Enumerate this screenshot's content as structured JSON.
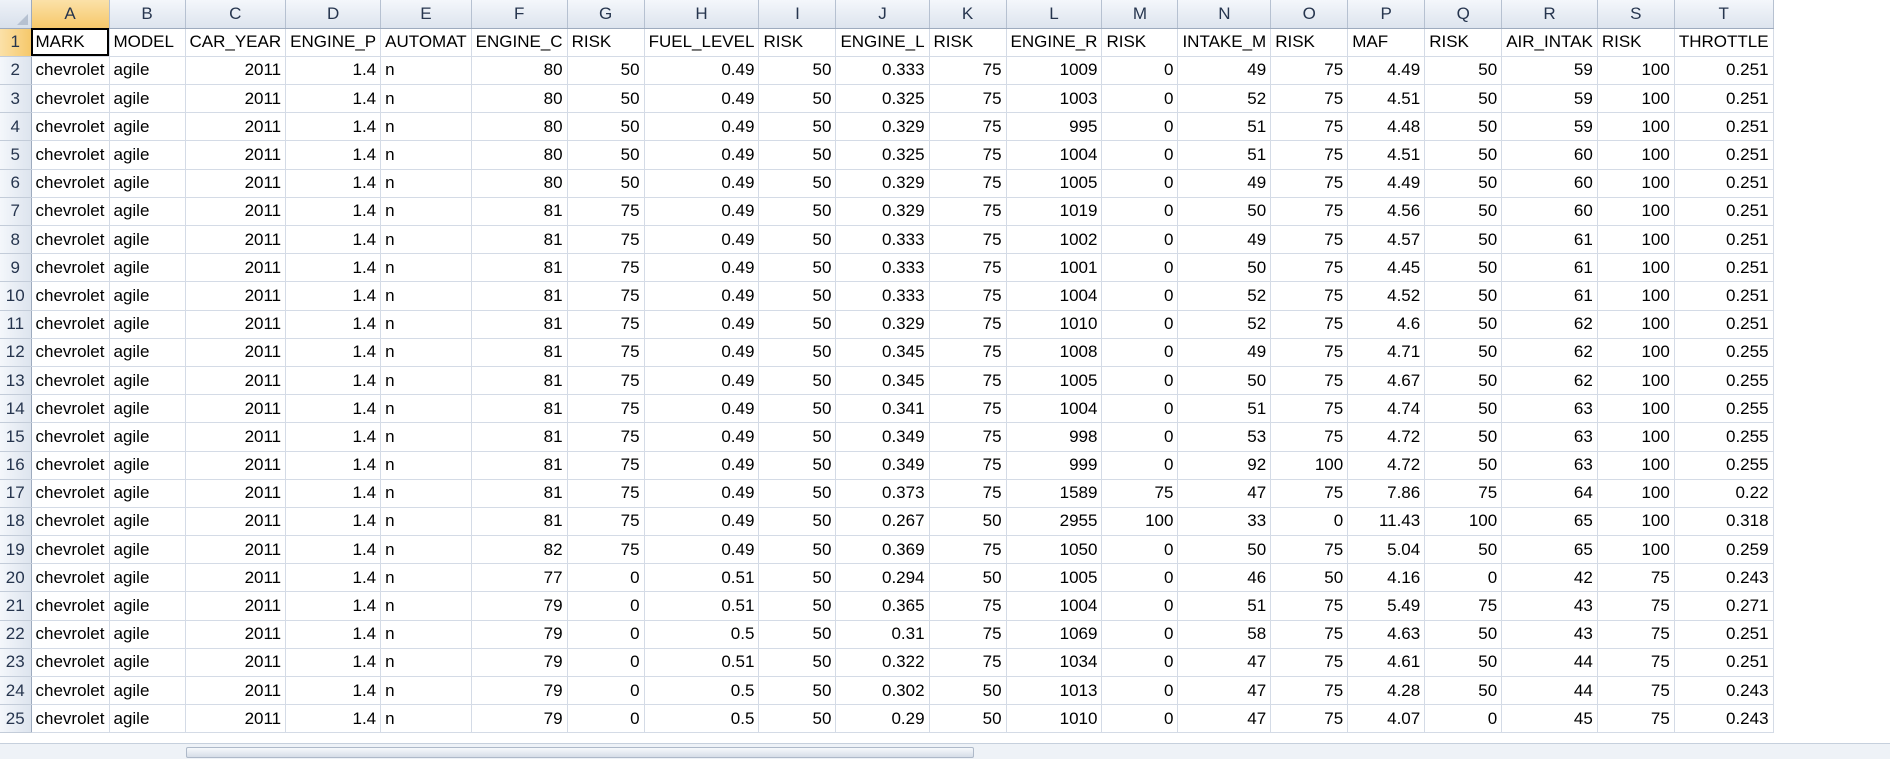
{
  "columns": [
    "A",
    "B",
    "C",
    "D",
    "E",
    "F",
    "G",
    "H",
    "I",
    "J",
    "K",
    "L",
    "M",
    "N",
    "O",
    "P",
    "Q",
    "R",
    "S",
    "T"
  ],
  "header_row": [
    "MARK",
    "MODEL",
    "CAR_YEAR",
    "ENGINE_P",
    "AUTOMAT",
    "ENGINE_C",
    "RISK",
    "FUEL_LEVEL",
    "RISK",
    "ENGINE_L",
    "RISK",
    "ENGINE_R",
    "RISK",
    "INTAKE_M",
    "RISK",
    "MAF",
    "RISK",
    "AIR_INTAK",
    "RISK",
    "THROTTLE"
  ],
  "rows": [
    [
      "chevrolet",
      "agile",
      "2011",
      "1.4",
      "n",
      "80",
      "50",
      "0.49",
      "50",
      "0.333",
      "75",
      "1009",
      "0",
      "49",
      "75",
      "4.49",
      "50",
      "59",
      "100",
      "0.251"
    ],
    [
      "chevrolet",
      "agile",
      "2011",
      "1.4",
      "n",
      "80",
      "50",
      "0.49",
      "50",
      "0.325",
      "75",
      "1003",
      "0",
      "52",
      "75",
      "4.51",
      "50",
      "59",
      "100",
      "0.251"
    ],
    [
      "chevrolet",
      "agile",
      "2011",
      "1.4",
      "n",
      "80",
      "50",
      "0.49",
      "50",
      "0.329",
      "75",
      "995",
      "0",
      "51",
      "75",
      "4.48",
      "50",
      "59",
      "100",
      "0.251"
    ],
    [
      "chevrolet",
      "agile",
      "2011",
      "1.4",
      "n",
      "80",
      "50",
      "0.49",
      "50",
      "0.325",
      "75",
      "1004",
      "0",
      "51",
      "75",
      "4.51",
      "50",
      "60",
      "100",
      "0.251"
    ],
    [
      "chevrolet",
      "agile",
      "2011",
      "1.4",
      "n",
      "80",
      "50",
      "0.49",
      "50",
      "0.329",
      "75",
      "1005",
      "0",
      "49",
      "75",
      "4.49",
      "50",
      "60",
      "100",
      "0.251"
    ],
    [
      "chevrolet",
      "agile",
      "2011",
      "1.4",
      "n",
      "81",
      "75",
      "0.49",
      "50",
      "0.329",
      "75",
      "1019",
      "0",
      "50",
      "75",
      "4.56",
      "50",
      "60",
      "100",
      "0.251"
    ],
    [
      "chevrolet",
      "agile",
      "2011",
      "1.4",
      "n",
      "81",
      "75",
      "0.49",
      "50",
      "0.333",
      "75",
      "1002",
      "0",
      "49",
      "75",
      "4.57",
      "50",
      "61",
      "100",
      "0.251"
    ],
    [
      "chevrolet",
      "agile",
      "2011",
      "1.4",
      "n",
      "81",
      "75",
      "0.49",
      "50",
      "0.333",
      "75",
      "1001",
      "0",
      "50",
      "75",
      "4.45",
      "50",
      "61",
      "100",
      "0.251"
    ],
    [
      "chevrolet",
      "agile",
      "2011",
      "1.4",
      "n",
      "81",
      "75",
      "0.49",
      "50",
      "0.333",
      "75",
      "1004",
      "0",
      "52",
      "75",
      "4.52",
      "50",
      "61",
      "100",
      "0.251"
    ],
    [
      "chevrolet",
      "agile",
      "2011",
      "1.4",
      "n",
      "81",
      "75",
      "0.49",
      "50",
      "0.329",
      "75",
      "1010",
      "0",
      "52",
      "75",
      "4.6",
      "50",
      "62",
      "100",
      "0.251"
    ],
    [
      "chevrolet",
      "agile",
      "2011",
      "1.4",
      "n",
      "81",
      "75",
      "0.49",
      "50",
      "0.345",
      "75",
      "1008",
      "0",
      "49",
      "75",
      "4.71",
      "50",
      "62",
      "100",
      "0.255"
    ],
    [
      "chevrolet",
      "agile",
      "2011",
      "1.4",
      "n",
      "81",
      "75",
      "0.49",
      "50",
      "0.345",
      "75",
      "1005",
      "0",
      "50",
      "75",
      "4.67",
      "50",
      "62",
      "100",
      "0.255"
    ],
    [
      "chevrolet",
      "agile",
      "2011",
      "1.4",
      "n",
      "81",
      "75",
      "0.49",
      "50",
      "0.341",
      "75",
      "1004",
      "0",
      "51",
      "75",
      "4.74",
      "50",
      "63",
      "100",
      "0.255"
    ],
    [
      "chevrolet",
      "agile",
      "2011",
      "1.4",
      "n",
      "81",
      "75",
      "0.49",
      "50",
      "0.349",
      "75",
      "998",
      "0",
      "53",
      "75",
      "4.72",
      "50",
      "63",
      "100",
      "0.255"
    ],
    [
      "chevrolet",
      "agile",
      "2011",
      "1.4",
      "n",
      "81",
      "75",
      "0.49",
      "50",
      "0.349",
      "75",
      "999",
      "0",
      "92",
      "100",
      "4.72",
      "50",
      "63",
      "100",
      "0.255"
    ],
    [
      "chevrolet",
      "agile",
      "2011",
      "1.4",
      "n",
      "81",
      "75",
      "0.49",
      "50",
      "0.373",
      "75",
      "1589",
      "75",
      "47",
      "75",
      "7.86",
      "75",
      "64",
      "100",
      "0.22"
    ],
    [
      "chevrolet",
      "agile",
      "2011",
      "1.4",
      "n",
      "81",
      "75",
      "0.49",
      "50",
      "0.267",
      "50",
      "2955",
      "100",
      "33",
      "0",
      "11.43",
      "100",
      "65",
      "100",
      "0.318"
    ],
    [
      "chevrolet",
      "agile",
      "2011",
      "1.4",
      "n",
      "82",
      "75",
      "0.49",
      "50",
      "0.369",
      "75",
      "1050",
      "0",
      "50",
      "75",
      "5.04",
      "50",
      "65",
      "100",
      "0.259"
    ],
    [
      "chevrolet",
      "agile",
      "2011",
      "1.4",
      "n",
      "77",
      "0",
      "0.51",
      "50",
      "0.294",
      "50",
      "1005",
      "0",
      "46",
      "50",
      "4.16",
      "0",
      "42",
      "75",
      "0.243"
    ],
    [
      "chevrolet",
      "agile",
      "2011",
      "1.4",
      "n",
      "79",
      "0",
      "0.51",
      "50",
      "0.365",
      "75",
      "1004",
      "0",
      "51",
      "75",
      "5.49",
      "75",
      "43",
      "75",
      "0.271"
    ],
    [
      "chevrolet",
      "agile",
      "2011",
      "1.4",
      "n",
      "79",
      "0",
      "0.5",
      "50",
      "0.31",
      "75",
      "1069",
      "0",
      "58",
      "75",
      "4.63",
      "50",
      "43",
      "75",
      "0.251"
    ],
    [
      "chevrolet",
      "agile",
      "2011",
      "1.4",
      "n",
      "79",
      "0",
      "0.51",
      "50",
      "0.322",
      "75",
      "1034",
      "0",
      "47",
      "75",
      "4.61",
      "50",
      "44",
      "75",
      "0.251"
    ],
    [
      "chevrolet",
      "agile",
      "2011",
      "1.4",
      "n",
      "79",
      "0",
      "0.5",
      "50",
      "0.302",
      "50",
      "1013",
      "0",
      "47",
      "75",
      "4.28",
      "50",
      "44",
      "75",
      "0.243"
    ],
    [
      "chevrolet",
      "agile",
      "2011",
      "1.4",
      "n",
      "79",
      "0",
      "0.5",
      "50",
      "0.29",
      "50",
      "1010",
      "0",
      "47",
      "75",
      "4.07",
      "0",
      "45",
      "75",
      "0.243"
    ]
  ],
  "theme": {
    "grid_line": "#d4dbe6",
    "header_bg": "#dde4ee",
    "active_header_bg": "#f6c86a"
  }
}
